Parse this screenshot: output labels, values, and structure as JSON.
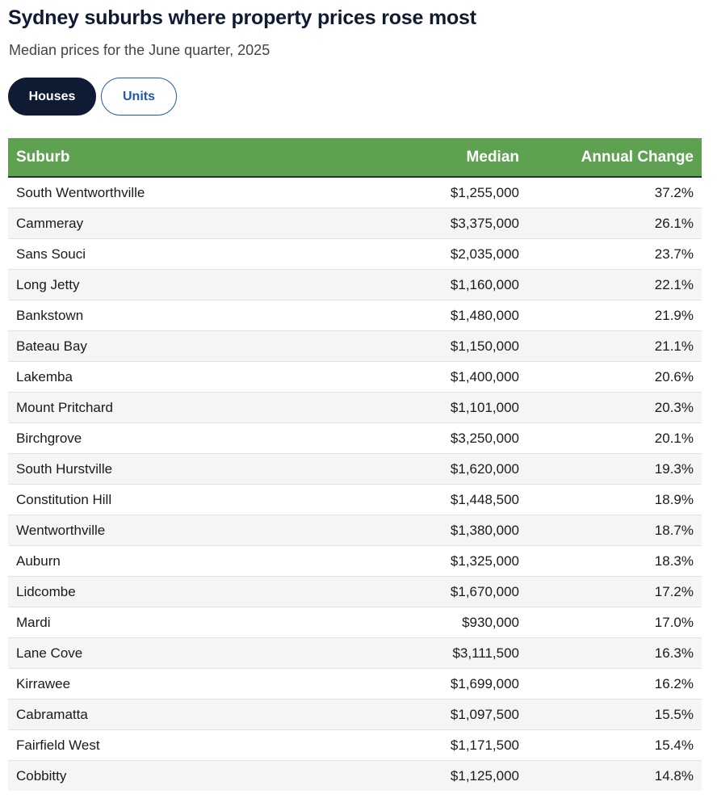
{
  "title": "Sydney suburbs where property prices rose most",
  "subtitle": "Median prices for the June quarter, 2025",
  "toggle": {
    "houses_label": "Houses",
    "units_label": "Units",
    "selected": "Houses"
  },
  "colors": {
    "header_bg": "#5ea150",
    "active_button": "#0f1a33",
    "link_blue": "#1f5aa8"
  },
  "chart_data": {
    "type": "table",
    "title": "Sydney suburbs where property prices rose most",
    "subtitle": "Median prices for the June quarter, 2025",
    "columns": [
      "Suburb",
      "Median",
      "Annual Change"
    ],
    "rows": [
      [
        "South Wentworthville",
        "$1,255,000",
        "37.2%"
      ],
      [
        "Cammeray",
        "$3,375,000",
        "26.1%"
      ],
      [
        "Sans Souci",
        "$2,035,000",
        "23.7%"
      ],
      [
        "Long Jetty",
        "$1,160,000",
        "22.1%"
      ],
      [
        "Bankstown",
        "$1,480,000",
        "21.9%"
      ],
      [
        "Bateau Bay",
        "$1,150,000",
        "21.1%"
      ],
      [
        "Lakemba",
        "$1,400,000",
        "20.6%"
      ],
      [
        "Mount Pritchard",
        "$1,101,000",
        "20.3%"
      ],
      [
        "Birchgrove",
        "$3,250,000",
        "20.1%"
      ],
      [
        "South Hurstville",
        "$1,620,000",
        "19.3%"
      ],
      [
        "Constitution Hill",
        "$1,448,500",
        "18.9%"
      ],
      [
        "Wentworthville",
        "$1,380,000",
        "18.7%"
      ],
      [
        "Auburn",
        "$1,325,000",
        "18.3%"
      ],
      [
        "Lidcombe",
        "$1,670,000",
        "17.2%"
      ],
      [
        "Mardi",
        "$930,000",
        "17.0%"
      ],
      [
        "Lane Cove",
        "$3,111,500",
        "16.3%"
      ],
      [
        "Kirrawee",
        "$1,699,000",
        "16.2%"
      ],
      [
        "Cabramatta",
        "$1,097,500",
        "15.5%"
      ],
      [
        "Fairfield West",
        "$1,171,500",
        "15.4%"
      ],
      [
        "Cobbitty",
        "$1,125,000",
        "14.8%"
      ]
    ]
  }
}
